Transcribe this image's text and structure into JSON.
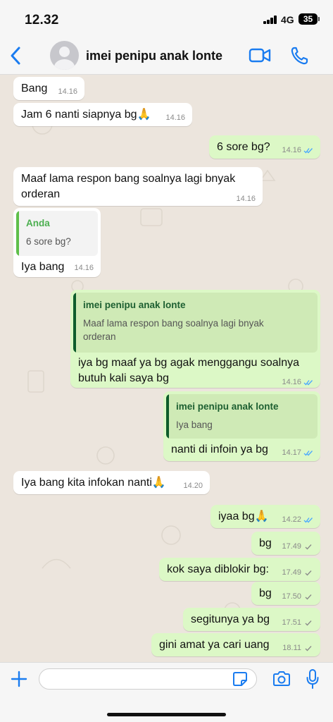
{
  "status_bar": {
    "time": "12.32",
    "network": "4G",
    "battery": "35"
  },
  "header": {
    "back_icon": "chevron-left-icon",
    "avatar_icon": "person-avatar-icon",
    "contact_name": "imei penipu anak lonte",
    "video_icon": "video-camera-icon",
    "call_icon": "phone-icon"
  },
  "colors": {
    "accent": "#1a7cf0",
    "incoming_bubble": "#ffffff",
    "outgoing_bubble": "#dcf8c6",
    "chat_background": "#ece5dd",
    "read_tick": "#4aa8ff"
  },
  "messages": [
    {
      "direction": "in",
      "text": "Bang",
      "time": "14.16"
    },
    {
      "direction": "in",
      "text": "Jam 6 nanti siapnya bg🙏",
      "time": "14.16"
    },
    {
      "direction": "out",
      "text": "6 sore bg?",
      "time": "14.16",
      "ticks": "read"
    },
    {
      "direction": "in",
      "text": "Maaf lama respon bang soalnya lagi bnyak orderan",
      "lines": [
        "Maaf lama respon bang soalnya lagi bnyak",
        "orderan"
      ],
      "time": "14.16"
    },
    {
      "direction": "in",
      "quote": {
        "name": "Anda",
        "text": "6 sore bg?"
      },
      "text": "Iya bang",
      "time": "14.16"
    },
    {
      "direction": "out",
      "quote": {
        "name": "imei penipu anak lonte",
        "text": "Maaf lama respon bang soalnya lagi bnyak orderan"
      },
      "text": "iya bg maaf ya bg agak menggangu soalnya butuh kali saya bg",
      "lines": [
        "iya bg maaf ya bg agak menggangu soalnya",
        "butuh kali saya bg"
      ],
      "time": "14.16",
      "ticks": "read"
    },
    {
      "direction": "out",
      "quote": {
        "name": "imei penipu anak lonte",
        "text": "Iya bang"
      },
      "text": "nanti di infoin ya bg",
      "time": "14.17",
      "ticks": "read"
    },
    {
      "direction": "in",
      "text": "Iya bang kita infokan nanti🙏",
      "time": "14.20"
    },
    {
      "direction": "out",
      "text": "iyaa bg🙏",
      "time": "14.22",
      "ticks": "read"
    },
    {
      "direction": "out",
      "text": "bg",
      "time": "17.49",
      "ticks": "sent"
    },
    {
      "direction": "out",
      "text": "kok saya diblokir bg:",
      "time": "17.49",
      "ticks": "sent"
    },
    {
      "direction": "out",
      "text": "bg",
      "time": "17.50",
      "ticks": "sent"
    },
    {
      "direction": "out",
      "text": "segitunya ya bg",
      "time": "17.51",
      "ticks": "sent"
    },
    {
      "direction": "out",
      "text": "gini amat ya cari uang",
      "time": "18.11",
      "ticks": "sent"
    }
  ],
  "input_bar": {
    "placeholder": "",
    "value": "",
    "icons": [
      "plus-icon",
      "sticker-icon",
      "camera-icon",
      "microphone-icon"
    ]
  }
}
